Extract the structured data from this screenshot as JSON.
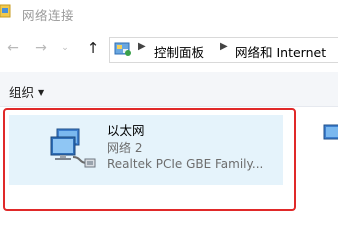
{
  "window": {
    "title": "网络连接"
  },
  "nav": {
    "back_icon": "arrow-left-icon",
    "forward_icon": "arrow-right-icon",
    "recent_icon": "chevron-down-icon",
    "up_icon": "arrow-up-icon"
  },
  "address": {
    "breadcrumb": [
      "控制面板",
      "网络和 Internet"
    ]
  },
  "commandbar": {
    "organize_label": "组织"
  },
  "adapters": [
    {
      "name": "以太网",
      "network": "网络 2",
      "description": "Realtek PCIe GBE Family..."
    }
  ],
  "colors": {
    "highlight_border": "#e02929",
    "selection_bg": "#e5f3fb",
    "secondary_text": "#6d6d6d"
  }
}
